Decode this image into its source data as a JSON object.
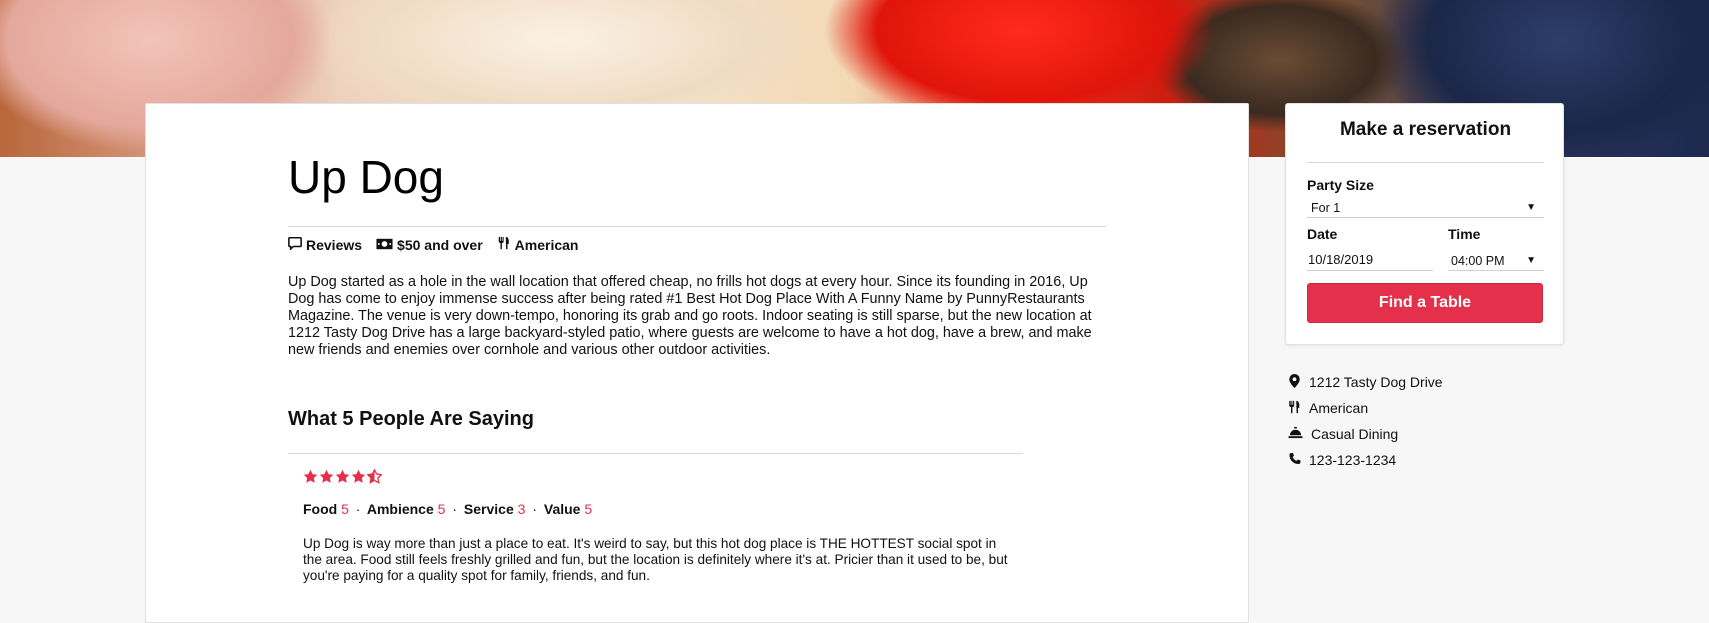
{
  "restaurant": {
    "name": "Up Dog",
    "meta": {
      "reviews_label": "Reviews",
      "price_label": "$50 and over",
      "cuisine_label": "American"
    },
    "description": "Up Dog started as a hole in the wall location that offered cheap, no frills hot dogs at every hour. Since its founding in 2016, Up Dog has come to enjoy immense success after being rated #1 Best Hot Dog Place With A Funny Name by PunnyRestaurants Magazine. The venue is very down-tempo, honoring its grab and go roots. Indoor seating is still sparse, but the new location at 1212 Tasty Dog Drive has a large backyard-styled patio, where guests are welcome to have a hot dog, have a brew, and make new friends and enemies over cornhole and various other outdoor activities."
  },
  "reviews_section": {
    "title": "What 5 People Are Saying",
    "review": {
      "stars": 4.5,
      "food_label": "Food",
      "food_value": "5",
      "ambience_label": "Ambience",
      "ambience_value": "5",
      "service_label": "Service",
      "service_value": "3",
      "value_label": "Value",
      "value_value": "5",
      "text": "Up Dog is way more than just a place to eat. It's weird to say, but this hot dog place is THE HOTTEST social spot in the area. Food still feels freshly grilled and fun, but the location is definitely where it's at. Pricier than it used to be, but you're paying for a quality spot for family, friends, and fun."
    }
  },
  "reservation": {
    "title": "Make a reservation",
    "party_size_label": "Party Size",
    "party_size_value": "For 1",
    "date_label": "Date",
    "date_value": "10/18/2019",
    "time_label": "Time",
    "time_value": "04:00 PM",
    "button_label": "Find a Table"
  },
  "info": {
    "address": "1212 Tasty Dog Drive",
    "cuisine": "American",
    "dining_style": "Casual Dining",
    "phone": "123-123-1234"
  },
  "colors": {
    "accent": "#e4304a"
  },
  "icons": {
    "reviews": "comment-icon",
    "price": "money-bill-icon",
    "cuisine": "utensils-icon",
    "address": "map-pin-icon",
    "dining": "service-bell-icon",
    "phone": "phone-icon",
    "rating": "star-icon"
  }
}
